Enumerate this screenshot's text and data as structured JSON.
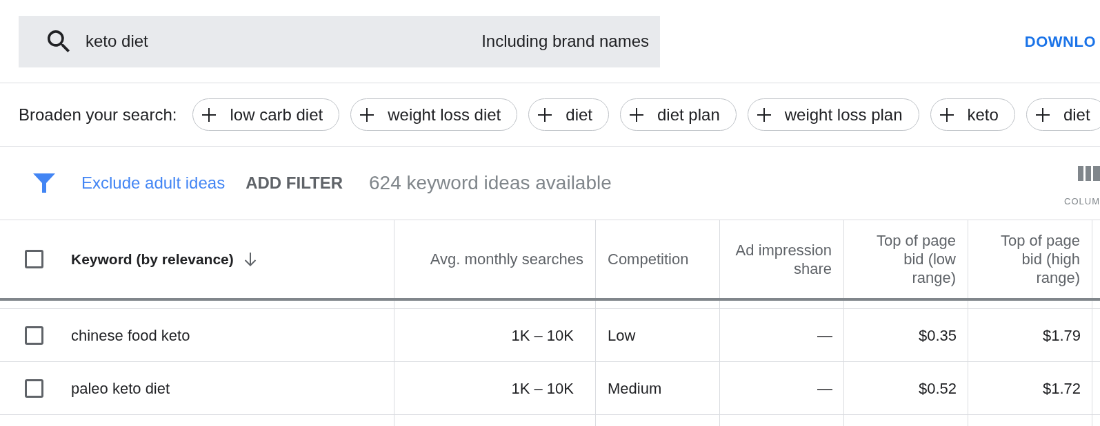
{
  "search": {
    "query": "keto diet",
    "option": "Including brand names"
  },
  "download": {
    "label": "DOWNLO"
  },
  "broaden": {
    "label": "Broaden your search:",
    "chips": [
      "low carb diet",
      "weight loss diet",
      "diet",
      "diet plan",
      "weight loss plan",
      "keto",
      "diet"
    ]
  },
  "filters": {
    "active": [
      "Exclude adult ideas"
    ],
    "add_filter": "ADD FILTER",
    "count": "624 keyword ideas available",
    "columns_button": "COLUM"
  },
  "table": {
    "select_all": {
      "checked": false
    },
    "columns": [
      {
        "label": "Keyword (by relevance)",
        "kind": "text",
        "sorted": true
      },
      {
        "label": "Avg. monthly searches",
        "kind": "number",
        "sorted": false
      },
      {
        "label": "Competition",
        "kind": "text",
        "sorted": false
      },
      {
        "label": "Ad impression share",
        "kind": "number",
        "sorted": false
      },
      {
        "label": "Top of page bid (low range)",
        "kind": "number",
        "sorted": false
      },
      {
        "label": "Top of page bid (high range)",
        "kind": "number",
        "sorted": false
      }
    ],
    "rows": [
      {
        "checked": false,
        "cells": [
          "chinese food keto",
          "1K – 10K",
          "Low",
          "—",
          "$0.35",
          "$1.79"
        ]
      },
      {
        "checked": false,
        "cells": [
          "paleo keto diet",
          "1K – 10K",
          "Medium",
          "—",
          "$0.52",
          "$1.72"
        ]
      }
    ]
  }
}
